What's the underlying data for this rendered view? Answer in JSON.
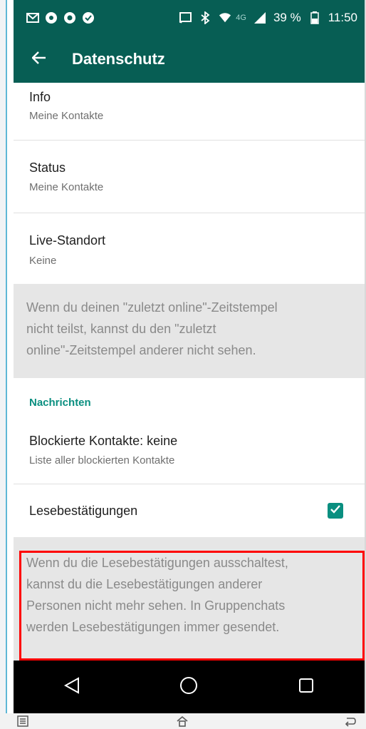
{
  "status_bar": {
    "network": "4G",
    "battery_percent": "39 %",
    "time": "11:50",
    "left_icons": [
      "gmail-icon",
      "chrome-icon",
      "record-icon",
      "check-circle-icon"
    ],
    "right_icons": [
      "cast-icon",
      "bluetooth-icon",
      "wifi-icon",
      "signal-icon",
      "battery-icon"
    ]
  },
  "app_bar": {
    "title": "Datenschutz"
  },
  "privacy_items": [
    {
      "label": "Info",
      "value": "Meine Kontakte"
    },
    {
      "label": "Status",
      "value": "Meine Kontakte"
    },
    {
      "label": "Live-Standort",
      "value": "Keine"
    }
  ],
  "last_seen_note": {
    "lines": [
      "Wenn du deinen \"zuletzt online\"-Zeitstempel",
      "nicht teilst, kannst du den \"zuletzt",
      "online\"-Zeitstempel anderer nicht sehen."
    ]
  },
  "messages_section": {
    "header": "Nachrichten",
    "blocked": {
      "label": "Blockierte Kontakte: keine",
      "sub": "Liste aller blockierten Kontakte"
    },
    "read_receipts": {
      "label": "Lesebestätigungen",
      "checked": true
    }
  },
  "read_receipts_note": {
    "lines": [
      "Wenn du die Lesebestätigungen ausschaltest,",
      "kannst du die Lesebestätigungen anderer",
      "Personen nicht mehr sehen. In Gruppenchats",
      "werden Lesebestätigungen immer gesendet."
    ]
  },
  "colors": {
    "primary_dark": "#075e54",
    "accent": "#0a8f80",
    "highlight": "#ff0000"
  },
  "nav_bar": [
    "back-triangle-icon",
    "home-circle-icon",
    "recents-square-icon"
  ]
}
